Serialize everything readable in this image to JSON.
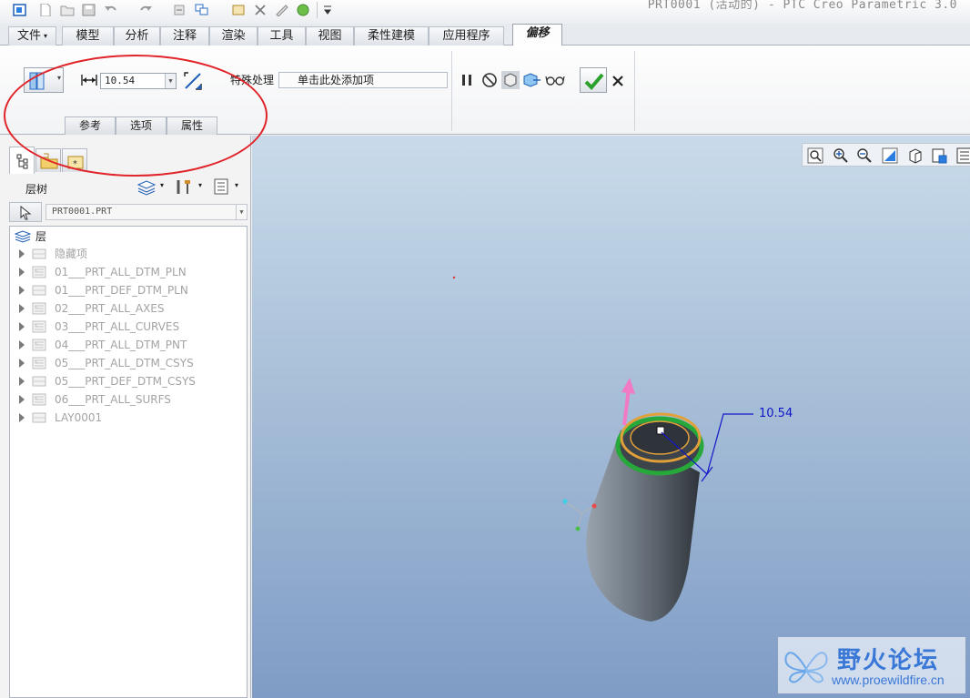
{
  "window": {
    "title": "PRT0001 (活动的) - PTC Creo Parametric 3.0"
  },
  "menu": {
    "tabs": [
      {
        "label": "文件",
        "dropdown": true
      },
      {
        "label": "模型"
      },
      {
        "label": "分析"
      },
      {
        "label": "注释"
      },
      {
        "label": "渲染"
      },
      {
        "label": "工具"
      },
      {
        "label": "视图"
      },
      {
        "label": "柔性建模"
      },
      {
        "label": "应用程序"
      },
      {
        "label": "偏移",
        "active": true
      }
    ]
  },
  "ribbon": {
    "offset_value": "10.54",
    "feature_label": "特殊处理",
    "feature_placeholder": "单击此处添加项",
    "subtabs": [
      "参考",
      "选项",
      "属性"
    ]
  },
  "left_panel": {
    "title": "层树",
    "model_path": "PRT0001.PRT",
    "root_label": "层",
    "layers": [
      "隐藏项",
      "01___PRT_ALL_DTM_PLN",
      "01___PRT_DEF_DTM_PLN",
      "02___PRT_ALL_AXES",
      "03___PRT_ALL_CURVES",
      "04___PRT_ALL_DTM_PNT",
      "05___PRT_ALL_DTM_CSYS",
      "05___PRT_DEF_DTM_CSYS",
      "06___PRT_ALL_SURFS",
      "LAY0001"
    ]
  },
  "viewport": {
    "dimension_label": "10.54"
  },
  "watermark": {
    "brand": "野火论坛",
    "url": "www.proewildfire.cn"
  },
  "colors": {
    "annotation": "#e0242a",
    "dimension": "#1515c8",
    "accept": "#2aa12a",
    "watermark": "#3a78d8"
  }
}
